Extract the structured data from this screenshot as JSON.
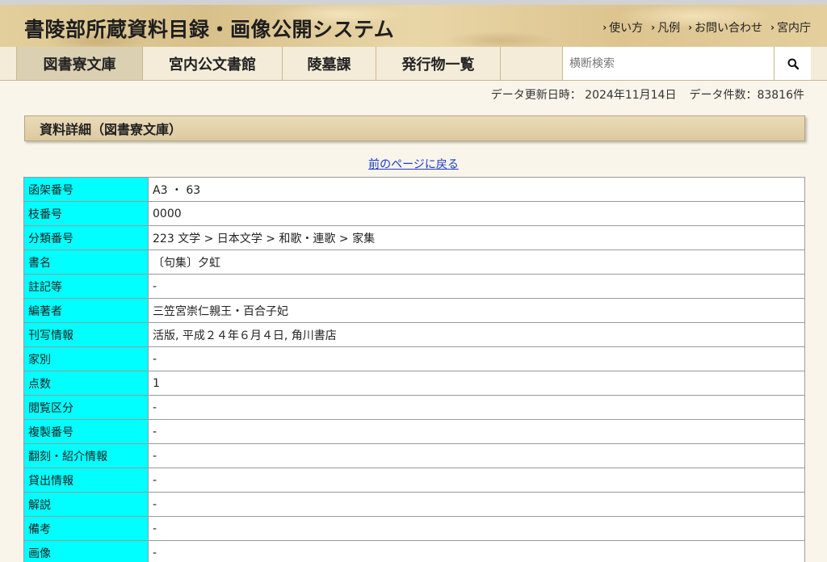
{
  "header": {
    "title": "書陵部所蔵資料目録・画像公開システム",
    "links": [
      {
        "label": "使い方"
      },
      {
        "label": "凡例"
      },
      {
        "label": "お問い合わせ"
      },
      {
        "label": "宮内庁"
      }
    ]
  },
  "nav": {
    "tabs": [
      {
        "label": "図書寮文庫",
        "active": true
      },
      {
        "label": "宮内公文書館"
      },
      {
        "label": "陵墓課"
      },
      {
        "label": "発行物一覧"
      }
    ],
    "search": {
      "placeholder": "横断検索",
      "value": ""
    }
  },
  "meta": {
    "updated": "データ更新日時： 2024年11月14日",
    "count": "データ件数：83816件"
  },
  "section": {
    "title": "資料詳細（図書寮文庫）",
    "back_link": "前のページに戻る"
  },
  "details": [
    {
      "label": "函架番号",
      "value": "A3 ・ 63"
    },
    {
      "label": "枝番号",
      "value": "0000"
    },
    {
      "label": "分類番号",
      "value": "223 文学 > 日本文学 > 和歌・連歌 > 家集"
    },
    {
      "label": "書名",
      "value": "〔句集〕夕虹"
    },
    {
      "label": "註記等",
      "value": "-"
    },
    {
      "label": "編著者",
      "value": "三笠宮崇仁親王・百合子妃"
    },
    {
      "label": "刊写情報",
      "value": "活版, 平成２４年６月４日, 角川書店"
    },
    {
      "label": "家別",
      "value": "-"
    },
    {
      "label": "点数",
      "value": "1"
    },
    {
      "label": "閲覧区分",
      "value": "-"
    },
    {
      "label": "複製番号",
      "value": "-"
    },
    {
      "label": "翻刻・紹介情報",
      "value": "-"
    },
    {
      "label": "貸出情報",
      "value": "-"
    },
    {
      "label": "解説",
      "value": "-"
    },
    {
      "label": "備考",
      "value": "-"
    },
    {
      "label": "画像",
      "value": "-"
    }
  ],
  "icons": {
    "search": "search-icon",
    "chevron": "chevron-right-icon"
  },
  "colors": {
    "label_bg": "#00ffff",
    "link": "#1a3cc8",
    "header_gold": "#dcc89a"
  }
}
